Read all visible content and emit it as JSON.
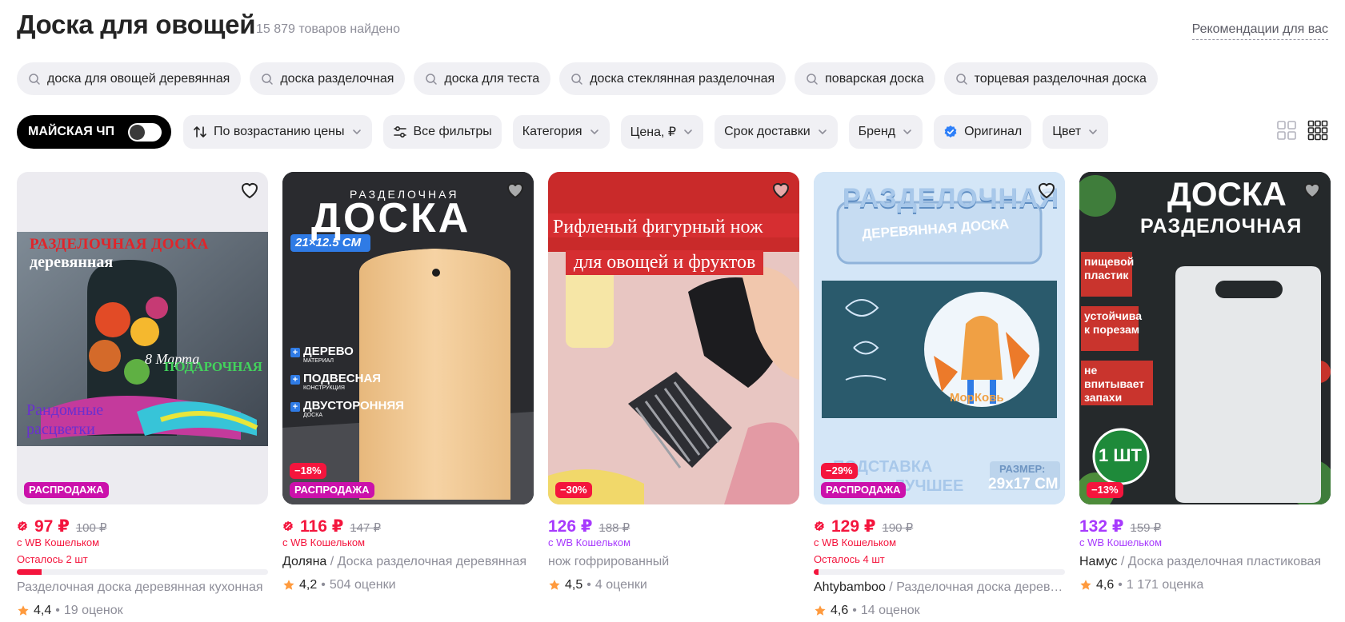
{
  "header": {
    "title": "Доска для овощей",
    "found": "15 879 товаров найдено",
    "recommendations": "Рекомендации для вас"
  },
  "suggestions": [
    "доска для овощей деревянная",
    "доска разделочная",
    "доска для теста",
    "доска стеклянная разделочная",
    "поварская доска",
    "торцевая разделочная доска"
  ],
  "filters": {
    "promo_label": "МАЙСКАЯ ЧП",
    "promo_enabled": false,
    "sort": "По возрастанию цены",
    "all_filters": "Все фильтры",
    "category": "Категория",
    "price": "Цена, ₽",
    "delivery": "Срок доставки",
    "brand": "Бренд",
    "original": "Оригинал",
    "original_checked": true,
    "color": "Цвет",
    "view_mode": "small-grid"
  },
  "colors": {
    "sale_red": "#f4153d",
    "wallet_purple": "#a73afd",
    "promo_pink": "#cb11ab",
    "chip_bg": "#f0f0f4"
  },
  "products": [
    {
      "image_text": {
        "line1": "РАЗДЕЛОЧНАЯ ДОСКА",
        "line2": "деревянная",
        "gift": "ПОДАРОЧНАЯ",
        "colors": "Рандомные расцветки",
        "date": "8 Марта"
      },
      "discount": "",
      "sale_badge": "РАСПРОДАЖА",
      "price": "97 ₽",
      "old_price": "100 ₽",
      "price_style": "red",
      "wallet": "с WB Кошельком",
      "stock": "Осталось 2 шт",
      "stock_level": 0.1,
      "brand": "",
      "name": "Разделочная доска деревянная кухонная",
      "rating": "4,4",
      "reviews": "19 оценок"
    },
    {
      "image_text": {
        "top": "РАЗДЕЛОЧНАЯ",
        "big": "ДОСКА",
        "size": "21×12.5 СМ",
        "f1": "ДЕРЕВО",
        "f1s": "МАТЕРИАЛ",
        "f2": "ПОДВЕСНАЯ",
        "f2s": "КОНСТРУКЦИЯ",
        "f3": "ДВУСТОРОННЯЯ",
        "f3s": "ДОСКА"
      },
      "discount": "−18%",
      "sale_badge": "РАСПРОДАЖА",
      "price": "116 ₽",
      "old_price": "147 ₽",
      "price_style": "red",
      "wallet": "с WB Кошельком",
      "stock": "",
      "brand": "Доляна",
      "name": "Доска разделочная деревянная",
      "rating": "4,2",
      "reviews": "504 оценки"
    },
    {
      "image_text": {
        "line1": "Рифленый фигурный нож",
        "line2": "для овощей и фруктов"
      },
      "discount": "−30%",
      "sale_badge": "",
      "price": "126 ₽",
      "old_price": "188 ₽",
      "price_style": "purple",
      "wallet": "с WB Кошельком",
      "stock": "",
      "brand": "",
      "name": "нож гофрированный",
      "rating": "4,5",
      "reviews": "4 оценки"
    },
    {
      "image_text": {
        "title": "РАЗДЕЛОЧНАЯ",
        "sub": "ДЕРЕВЯННАЯ ДОСКА",
        "brand": "МорКовь",
        "stand": "ПОДСТАВКА",
        "stand2": "ЛУЧШЕЕ",
        "size_label": "РАЗМЕР:",
        "size": "29x17 СМ"
      },
      "discount": "−29%",
      "sale_badge": "РАСПРОДАЖА",
      "price": "129 ₽",
      "old_price": "190 ₽",
      "price_style": "red",
      "wallet": "с WB Кошельком",
      "stock": "Осталось 4 шт",
      "stock_level": 0.02,
      "brand": "Ahtybamboo",
      "name": "Разделочная доска деревянная",
      "rating": "4,6",
      "reviews": "14 оценок"
    },
    {
      "image_text": {
        "title": "ДОСКА",
        "sub": "РАЗДЕЛОЧНАЯ",
        "f1": "пищевой пластик",
        "f2": "устойчива к порезам",
        "f3": "не впитывает запахи",
        "qty": "1 ШТ"
      },
      "discount": "−13%",
      "sale_badge": "",
      "price": "132 ₽",
      "old_price": "159 ₽",
      "price_style": "purple",
      "wallet": "с WB Кошельком",
      "stock": "",
      "brand": "Намус",
      "name": "Доска разделочная пластиковая",
      "rating": "4,6",
      "reviews": "1 171 оценка"
    }
  ]
}
